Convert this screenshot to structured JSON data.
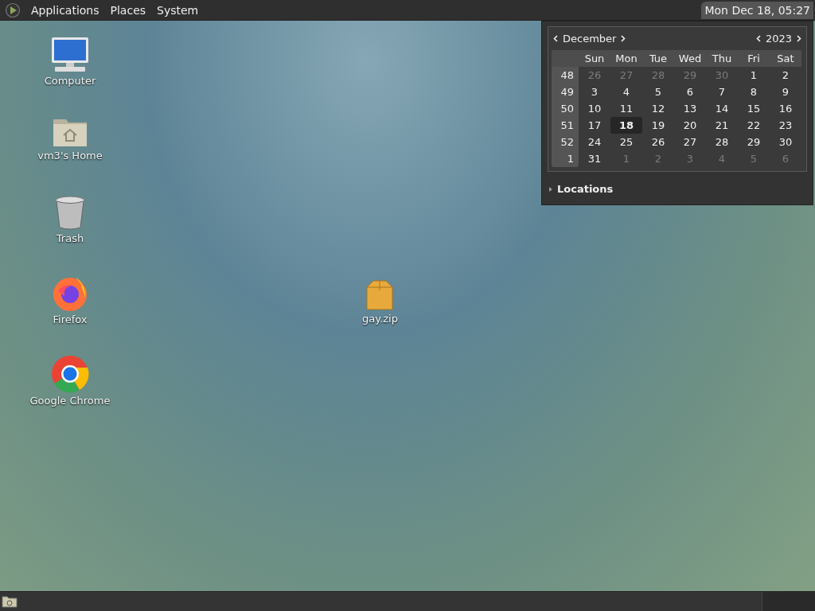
{
  "top_panel": {
    "menus": [
      {
        "label": "Applications"
      },
      {
        "label": "Places"
      },
      {
        "label": "System"
      }
    ],
    "clock": "Mon Dec 18, 05:27"
  },
  "desktop_icons": [
    {
      "kind": "computer",
      "label": "Computer"
    },
    {
      "kind": "home",
      "label": "vm3's Home"
    },
    {
      "kind": "trash",
      "label": "Trash"
    },
    {
      "kind": "firefox",
      "label": "Firefox"
    },
    {
      "kind": "chrome",
      "label": "Google Chrome"
    }
  ],
  "file_icon": {
    "kind": "archive",
    "label": "gay.zip"
  },
  "calendar": {
    "month": "December",
    "year": "2023",
    "weekdays": [
      "Sun",
      "Mon",
      "Tue",
      "Wed",
      "Thu",
      "Fri",
      "Sat"
    ],
    "weeks": [
      {
        "number": "48",
        "days": [
          {
            "text": "26",
            "dim": true,
            "selected": false
          },
          {
            "text": "27",
            "dim": true,
            "selected": false
          },
          {
            "text": "28",
            "dim": true,
            "selected": false
          },
          {
            "text": "29",
            "dim": true,
            "selected": false
          },
          {
            "text": "30",
            "dim": true,
            "selected": false
          },
          {
            "text": "1",
            "dim": false,
            "selected": false
          },
          {
            "text": "2",
            "dim": false,
            "selected": false
          }
        ]
      },
      {
        "number": "49",
        "days": [
          {
            "text": "3",
            "dim": false,
            "selected": false
          },
          {
            "text": "4",
            "dim": false,
            "selected": false
          },
          {
            "text": "5",
            "dim": false,
            "selected": false
          },
          {
            "text": "6",
            "dim": false,
            "selected": false
          },
          {
            "text": "7",
            "dim": false,
            "selected": false
          },
          {
            "text": "8",
            "dim": false,
            "selected": false
          },
          {
            "text": "9",
            "dim": false,
            "selected": false
          }
        ]
      },
      {
        "number": "50",
        "days": [
          {
            "text": "10",
            "dim": false,
            "selected": false
          },
          {
            "text": "11",
            "dim": false,
            "selected": false
          },
          {
            "text": "12",
            "dim": false,
            "selected": false
          },
          {
            "text": "13",
            "dim": false,
            "selected": false
          },
          {
            "text": "14",
            "dim": false,
            "selected": false
          },
          {
            "text": "15",
            "dim": false,
            "selected": false
          },
          {
            "text": "16",
            "dim": false,
            "selected": false
          }
        ]
      },
      {
        "number": "51",
        "days": [
          {
            "text": "17",
            "dim": false,
            "selected": false
          },
          {
            "text": "18",
            "dim": false,
            "selected": true
          },
          {
            "text": "19",
            "dim": false,
            "selected": false
          },
          {
            "text": "20",
            "dim": false,
            "selected": false
          },
          {
            "text": "21",
            "dim": false,
            "selected": false
          },
          {
            "text": "22",
            "dim": false,
            "selected": false
          },
          {
            "text": "23",
            "dim": false,
            "selected": false
          }
        ]
      },
      {
        "number": "52",
        "days": [
          {
            "text": "24",
            "dim": false,
            "selected": false
          },
          {
            "text": "25",
            "dim": false,
            "selected": false
          },
          {
            "text": "26",
            "dim": false,
            "selected": false
          },
          {
            "text": "27",
            "dim": false,
            "selected": false
          },
          {
            "text": "28",
            "dim": false,
            "selected": false
          },
          {
            "text": "29",
            "dim": false,
            "selected": false
          },
          {
            "text": "30",
            "dim": false,
            "selected": false
          }
        ]
      },
      {
        "number": "1",
        "days": [
          {
            "text": "31",
            "dim": false,
            "selected": false
          },
          {
            "text": "1",
            "dim": true,
            "selected": false
          },
          {
            "text": "2",
            "dim": true,
            "selected": false
          },
          {
            "text": "3",
            "dim": true,
            "selected": false
          },
          {
            "text": "4",
            "dim": true,
            "selected": false
          },
          {
            "text": "5",
            "dim": true,
            "selected": false
          },
          {
            "text": "6",
            "dim": true,
            "selected": false
          }
        ]
      }
    ],
    "locations": {
      "label": "Locations",
      "expanded": false
    }
  }
}
